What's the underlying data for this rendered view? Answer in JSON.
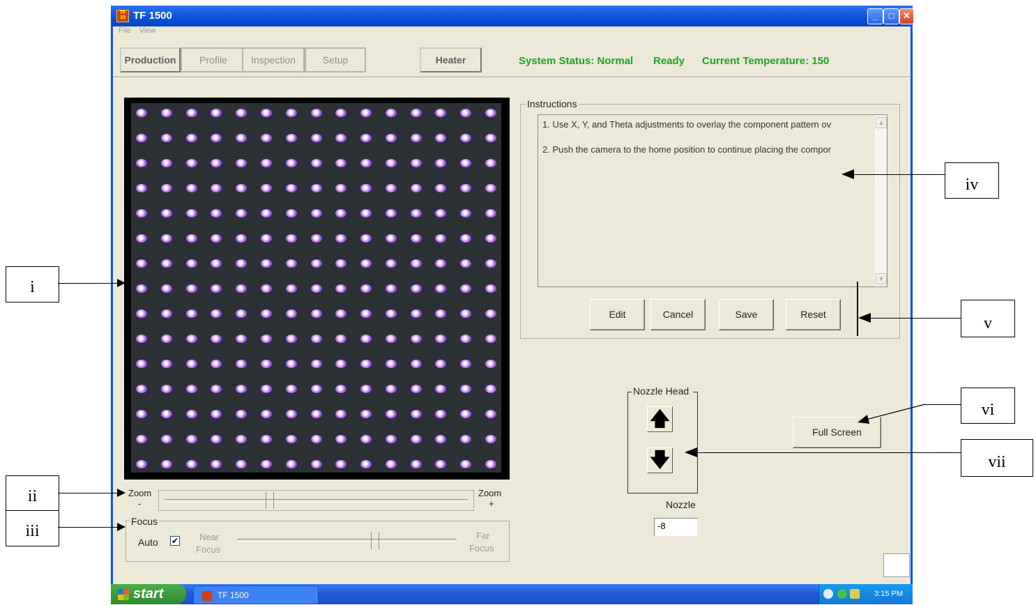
{
  "window": {
    "title": "TF 1500"
  },
  "menu": [
    "File",
    "View"
  ],
  "tabs": [
    {
      "label": "Production",
      "active": true
    },
    {
      "label": "Profile",
      "active": false
    },
    {
      "label": "Inspection",
      "active": false
    },
    {
      "label": "Setup",
      "active": false
    }
  ],
  "heater_label": "Heater",
  "status": {
    "system": "System Status: Normal",
    "ready": "Ready",
    "temperature": "Current Temperature: 150",
    "color": "#1ea324"
  },
  "zoom": {
    "left_label": "Zoom",
    "left_sign": "-",
    "right_label": "Zoom",
    "right_sign": "+",
    "level_fraction": 0.34
  },
  "focus": {
    "group_label": "Focus",
    "auto_label": "Auto",
    "auto_checked": true,
    "auto_mark": "✔",
    "near_line1": "Near",
    "near_line2": "Focus",
    "far_line1": "Far",
    "far_line2": "Focus",
    "level_fraction": 0.63
  },
  "instructions": {
    "group_label": "Instructions",
    "lines": [
      "1. Use X, Y, and Theta adjustments to overlay the component pattern ov",
      "2. Push the camera to the home position to continue placing the compor"
    ]
  },
  "buttons": {
    "edit": "Edit",
    "cancel": "Cancel",
    "save": "Save",
    "reset": "Reset",
    "full_screen": "Full Screen"
  },
  "nozzle": {
    "group_label": "Nozzle Head",
    "up_icon": "arrow-up-icon",
    "down_icon": "arrow-down-icon",
    "value_label": "Nozzle",
    "value": "-8"
  },
  "taskbar": {
    "start_label": "start",
    "task_label": "TF 1500",
    "clock": "3:15 PM"
  },
  "annotations": [
    "i",
    "ii",
    "iii",
    "iv",
    "v",
    "vi",
    "vii"
  ]
}
